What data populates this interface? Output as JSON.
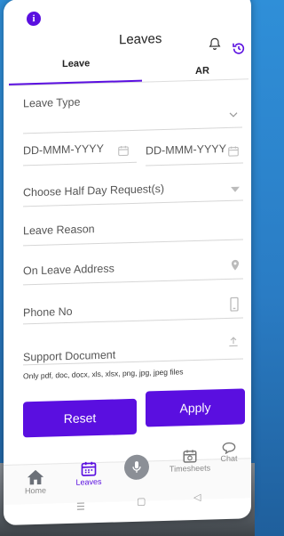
{
  "header": {
    "title": "Leaves",
    "info_symbol": "i"
  },
  "tabs": [
    {
      "label": "Leave",
      "active": true
    },
    {
      "label": "AR",
      "active": false
    }
  ],
  "form": {
    "leave_type": "Leave Type",
    "from_date": "DD-MMM-YYYY",
    "to_date": "DD-MMM-YYYY",
    "half_day": "Choose Half Day Request(s)",
    "leave_reason": "Leave Reason",
    "on_leave_address": "On Leave Address",
    "phone_no": "Phone No",
    "support_document": "Support Document",
    "file_hint": "Only pdf, doc, docx, xls, xlsx, png, jpg, jpeg files"
  },
  "actions": {
    "reset": "Reset",
    "apply": "Apply"
  },
  "bottom_nav": [
    {
      "label": "Home",
      "icon": "home-icon",
      "active": false
    },
    {
      "label": "Leaves",
      "icon": "calendar-icon",
      "active": true
    },
    {
      "label": "",
      "icon": "mic-icon",
      "active": false
    },
    {
      "label": "Timesheets",
      "icon": "timesheet-icon",
      "active": false
    },
    {
      "label": "Chat",
      "icon": "chat-icon",
      "active": false
    }
  ],
  "colors": {
    "accent": "#5a0fe0",
    "background": "#2f8fd8"
  }
}
